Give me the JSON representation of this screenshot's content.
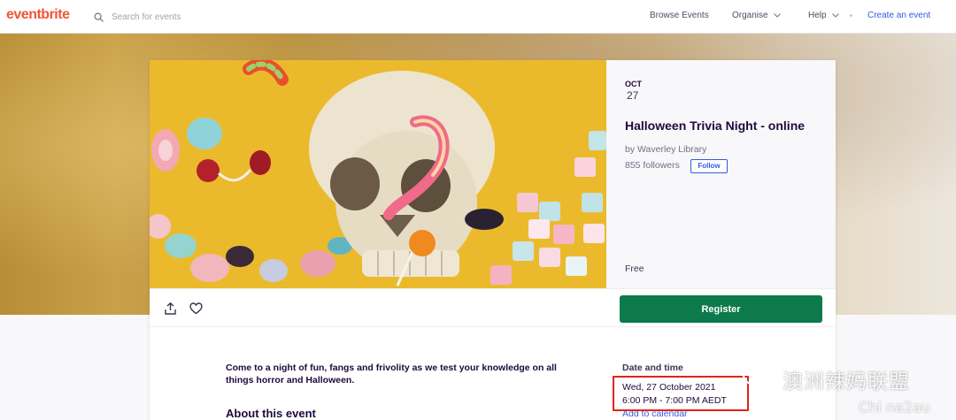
{
  "nav": {
    "logo": "eventbrite",
    "search_placeholder": "Search for events",
    "browse": "Browse Events",
    "organise": "Organise",
    "help": "Help",
    "create": "Create an event"
  },
  "event": {
    "month": "OCT",
    "day": "27",
    "title": "Halloween Trivia Night - online",
    "organizer": "by Waverley Library",
    "followers": "855 followers",
    "follow_label": "Follow",
    "price": "Free",
    "register_label": "Register",
    "description": "Come to a night of fun, fangs and frivolity as we test your knowledge on all things horror and Halloween.",
    "about_heading": "About this event"
  },
  "date_time": {
    "heading": "Date and time",
    "date": "Wed, 27 October 2021",
    "time": "6:00 PM - 7:00 PM AEDT",
    "add_to_calendar": "Add to calendar"
  },
  "watermark": {
    "text": "澳洲辣妈联盟",
    "sub": "Chi na2au"
  },
  "colors": {
    "brand": "#f05537",
    "link": "#3659e3",
    "register": "#0d7a4b",
    "highlight": "#e2231a",
    "hero_bg": "#ebba2c"
  }
}
